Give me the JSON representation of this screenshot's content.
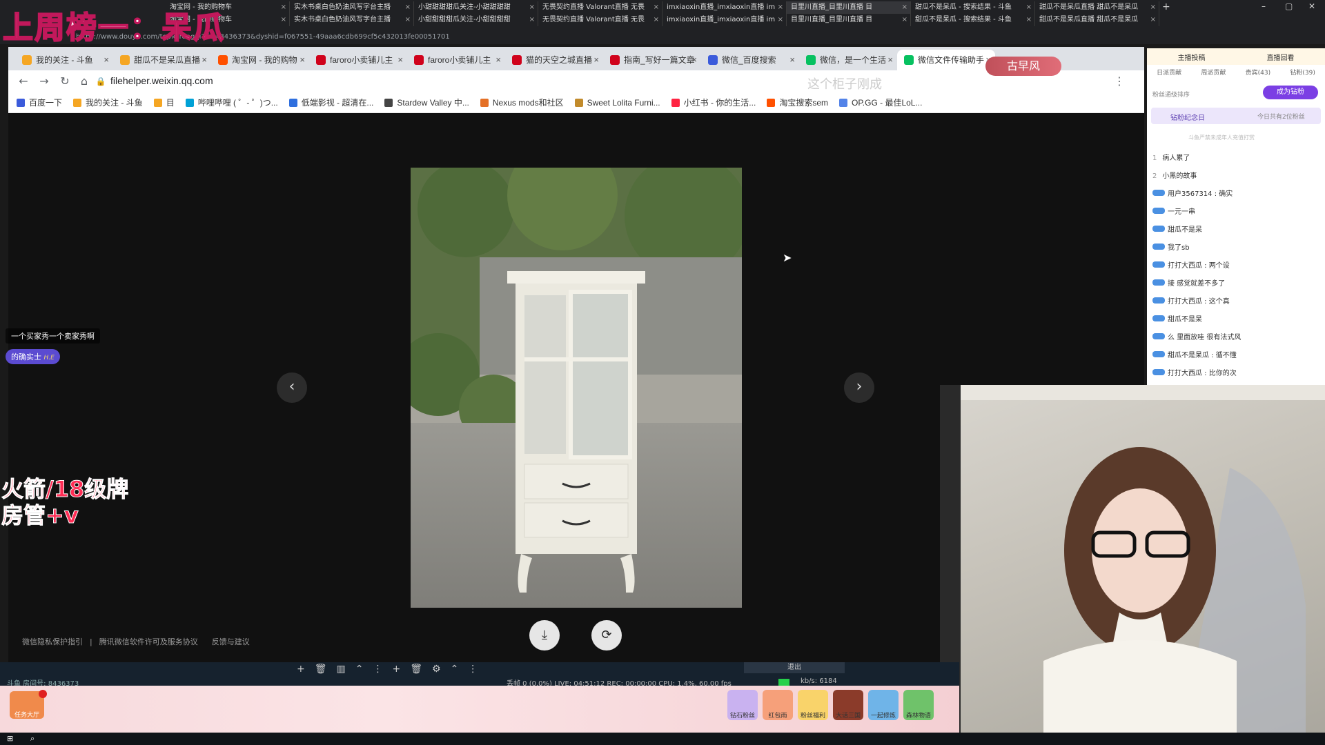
{
  "overlay": {
    "stream_title": "上周榜一：呆瓜",
    "fan_badge_line1": "火箭/18级牌",
    "fan_badge_line2": "房管+v",
    "chat_bubble_1": "一个买家秀一个卖家秀啊",
    "chat_bubble_2": "的确实士",
    "chat_bubble_2_tag": "H.E",
    "scroll_banner": "这个柜子刚成",
    "room_tag": "古早风"
  },
  "outer_browser": {
    "tabs_row1": [
      {
        "title": "淘宝网 - 我的购物车"
      },
      {
        "title": "实木书桌白色奶油风写字台主播"
      },
      {
        "title": "小甜甜甜甜瓜关注-小甜甜甜甜"
      },
      {
        "title": "无畏契约直播 Valorant直播 无畏"
      },
      {
        "title": "imxiaoxin直播_imxiaoxin直播 im"
      },
      {
        "title": "目里川直播_目里川直播 目"
      },
      {
        "title": "甜瓜不是呆瓜 - 搜索结果 - 斗鱼"
      },
      {
        "title": "甜瓜不是呆瓜直播 甜瓜不是呆瓜"
      }
    ],
    "tabs_row2": [
      {
        "title": "淘宝网 - 我的购物车"
      },
      {
        "title": "实木书桌白色奶油风写字台主播"
      },
      {
        "title": "小甜甜甜甜瓜关注-小甜甜甜甜"
      },
      {
        "title": "无畏契约直播 Valorant直播 无畏"
      },
      {
        "title": "imxiaoxin直播_imxiaoxin直播 im"
      },
      {
        "title": "目里川直播_目里川直播 目"
      },
      {
        "title": "甜瓜不是呆瓜 - 搜索结果 - 斗鱼"
      },
      {
        "title": "甜瓜不是呆瓜直播 甜瓜不是呆瓜"
      }
    ],
    "url": "https://www.douyu.com/topic/rongqi?rid=8436373&dyshid=f067551-49aaa6cdb699cf5c432013fe00051701"
  },
  "inner_browser": {
    "tabs": [
      {
        "title": "我的关注 - 斗鱼",
        "color": "#f5a623"
      },
      {
        "title": "甜瓜不是呆瓜直播",
        "color": "#f5a623"
      },
      {
        "title": "淘宝网 - 我的购物",
        "color": "#ff5000"
      },
      {
        "title": "faroro小卖铺儿主",
        "color": "#d0021b"
      },
      {
        "title": "faroro小卖铺儿主",
        "color": "#d0021b"
      },
      {
        "title": "猫的天空之城直播",
        "color": "#d0021b"
      },
      {
        "title": "指南_写好一篇文章",
        "color": "#d0021b"
      },
      {
        "title": "微信_百度搜索",
        "color": "#3b5bdb"
      },
      {
        "title": "微信，是一个生活",
        "color": "#07c160"
      },
      {
        "title": "微信文件传输助手",
        "color": "#07c160"
      }
    ],
    "url": "filehelper.weixin.qq.com",
    "bookmarks": [
      {
        "label": "百度一下",
        "color": "#3b5bdb"
      },
      {
        "label": "我的关注 - 斗鱼",
        "color": "#f5a623"
      },
      {
        "label": "目",
        "color": "#f5a623"
      },
      {
        "label": "哔哩哔哩 ( ゜- ゜)つ...",
        "color": "#00a1d6"
      },
      {
        "label": "低端影视 - 超清在...",
        "color": "#2f6fde"
      },
      {
        "label": "Stardew Valley 中...",
        "color": "#444444"
      },
      {
        "label": "Nexus mods和社区",
        "color": "#e47026"
      },
      {
        "label": "Sweet Lolita Furni...",
        "color": "#c28b2c"
      },
      {
        "label": "小红书 - 你的生活...",
        "color": "#ff2442"
      },
      {
        "label": "淘宝搜索sem",
        "color": "#ff5000"
      },
      {
        "label": "OP.GG - 最佳LoL...",
        "color": "#5383e8"
      }
    ]
  },
  "viewer": {
    "prev_icon": "‹",
    "next_icon": "›",
    "footer_links": [
      "微信隐私保护指引",
      "腾讯微信软件许可及服务协议",
      "反馈与建议"
    ]
  },
  "right_panel": {
    "tabs": [
      "主播投稿",
      "直播回看"
    ],
    "subtabs": [
      "日派贡献",
      "周派贡献",
      "贵宾(43)",
      "钻粉(39)"
    ],
    "fan_rank_label": "粉丝通级排序",
    "become_fan_button": "成为钻粉",
    "anniversary_label": "钻粉纪念日",
    "anniversary_note": "今日共有2位粉丝",
    "notice": "斗鱼严禁未成年人充值打赏",
    "chat": [
      {
        "rank": "1",
        "text": "病人累了"
      },
      {
        "rank": "2",
        "text": "小黑的故事"
      },
      {
        "text": "用户3567314 : 确实"
      },
      {
        "text": "一元一串"
      },
      {
        "text": "甜瓜不是呆"
      },
      {
        "text": "我了sb"
      },
      {
        "text": "打打大西瓜 : 两个设"
      },
      {
        "text": "接 感觉就差不多了"
      },
      {
        "text": "打打大西瓜 : 这个真"
      },
      {
        "text": "甜瓜不是呆"
      },
      {
        "text": "么 里面放哇 很有法式风"
      },
      {
        "text": "甜瓜不是呆瓜 : 循不懂"
      },
      {
        "text": "打打大西瓜 : 比你的次"
      }
    ]
  },
  "obs_bar": {
    "status": "丢帧 0 (0.0%)   LIVE: 04:51:12   REC: 00:00:00   CPU: 1.4%, 60.00 fps",
    "kbps": "kb/s: 6184",
    "room_id": "斗鱼 房间号: 8436373",
    "exit_label": "退出"
  },
  "gift_bar": {
    "task_label": "任务大厅",
    "gifts": [
      "钻石粉丝",
      "红包雨",
      "粉丝福利",
      "大话三国",
      "一起修炼",
      "森林物语"
    ]
  }
}
